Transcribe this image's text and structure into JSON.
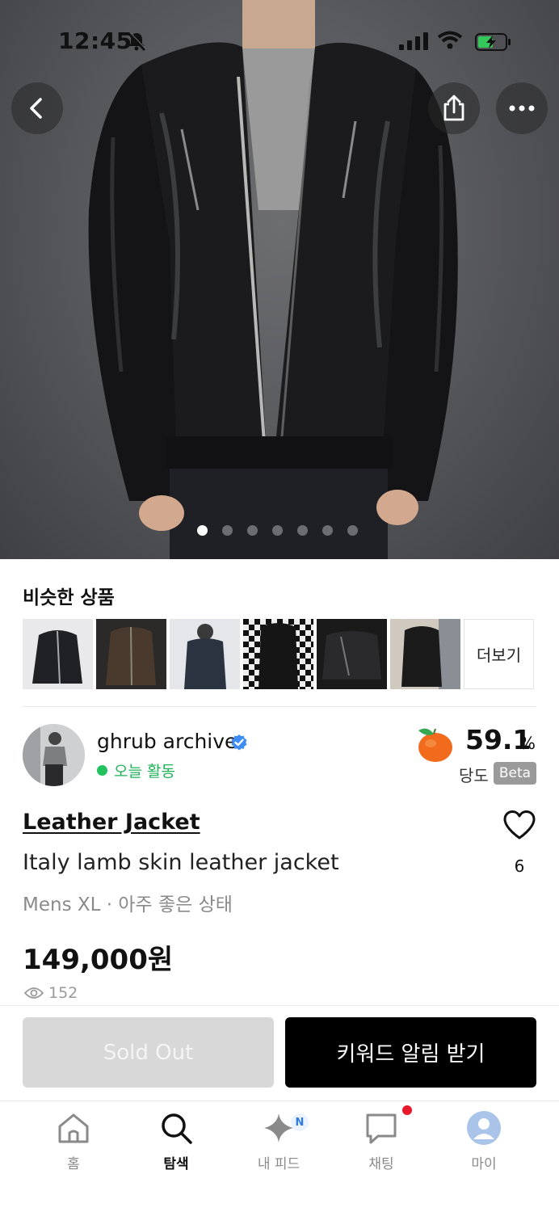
{
  "status_bar": {
    "time": "12:45"
  },
  "hero": {
    "image_count": 7,
    "active_index": 0
  },
  "similar": {
    "title": "비슷한 상품",
    "more_label": "더보기",
    "thumb_count": 6
  },
  "seller": {
    "name": "ghrub archive",
    "activity": "오늘 활동",
    "score": "59.1",
    "score_unit": "%",
    "score_label": "당도",
    "beta_label": "Beta"
  },
  "product": {
    "brand": "Leather Jacket",
    "title": "Italy lamb skin leather jacket",
    "meta": "Mens XL · 아주 좋은 상태",
    "price": "149,000원",
    "views": "152",
    "likes": "6"
  },
  "actions": {
    "sold_out_label": "Sold Out",
    "keyword_label": "키워드 알림 받기"
  },
  "tabs": [
    {
      "label": "홈",
      "icon": "home-icon"
    },
    {
      "label": "탐색",
      "icon": "search-icon",
      "active": true
    },
    {
      "label": "내 피드",
      "icon": "sparkle-icon",
      "badge": "N"
    },
    {
      "label": "채팅",
      "icon": "chat-icon"
    },
    {
      "label": "마이",
      "icon": "profile-icon"
    }
  ],
  "colors": {
    "accent_green": "#22c35e",
    "verified_blue": "#3d8df5",
    "peach_orange": "#f26b1d",
    "cta_black": "#000000",
    "disabled_gray": "#d8d8d8",
    "notification_red": "#e8182a"
  }
}
